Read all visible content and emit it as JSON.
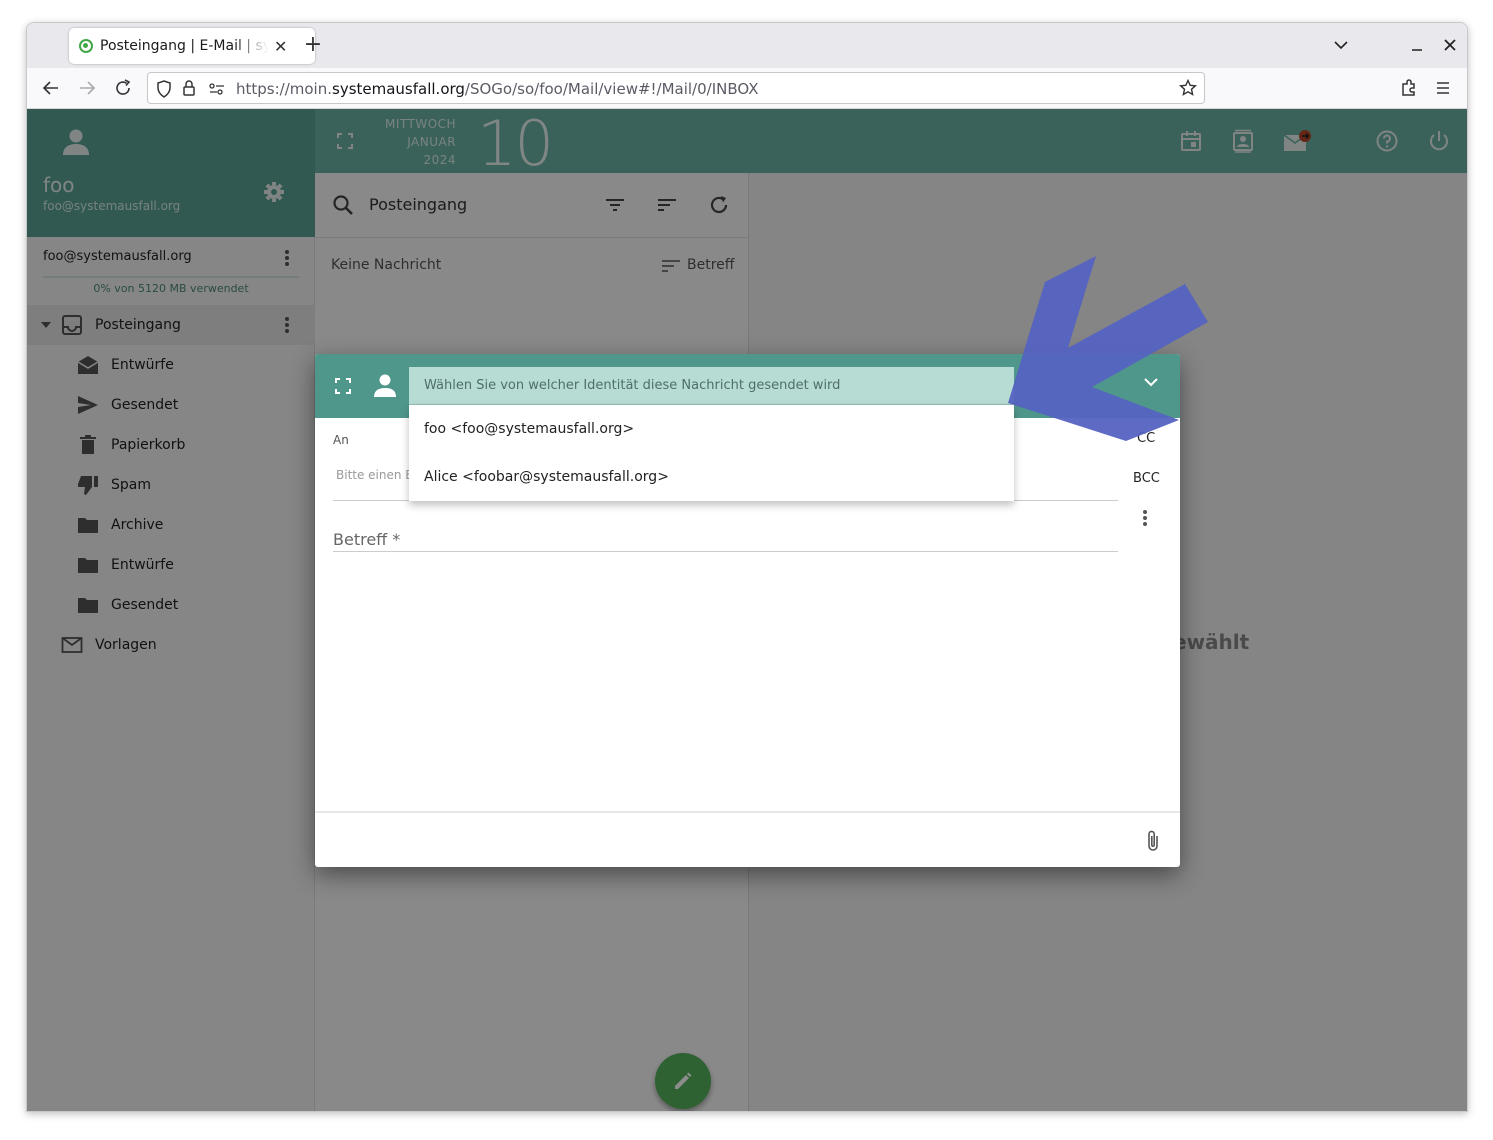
{
  "browser": {
    "tab_title": "Posteingang | E-Mail | systemausfall",
    "url_prefix": "https://moin.",
    "url_domain": "systemausfall.org",
    "url_path": "/SOGo/so/foo/Mail/view#!/Mail/0/INBOX"
  },
  "user": {
    "name": "foo",
    "email": "foo@systemausfall.org"
  },
  "account": {
    "label": "foo@systemausfall.org",
    "quota": "0% von 5120 MB verwendet"
  },
  "folders": [
    {
      "label": "Posteingang",
      "icon": "inbox-icon"
    },
    {
      "label": "Entwürfe",
      "icon": "drafts-icon"
    },
    {
      "label": "Gesendet",
      "icon": "send-icon"
    },
    {
      "label": "Papierkorb",
      "icon": "trash-icon"
    },
    {
      "label": "Spam",
      "icon": "thumb-down-icon"
    },
    {
      "label": "Archive",
      "icon": "folder-icon"
    },
    {
      "label": "Entwürfe",
      "icon": "folder-icon"
    },
    {
      "label": "Gesendet",
      "icon": "folder-icon"
    },
    {
      "label": "Vorlagen",
      "icon": "mail-icon"
    }
  ],
  "date": {
    "weekday": "MITTWOCH",
    "month": "JANUAR",
    "year": "2024",
    "day": "10"
  },
  "list": {
    "search_label": "Posteingang",
    "empty_text": "Keine Nachricht",
    "sort_label": "Betreff"
  },
  "view": {
    "text": "ewählt"
  },
  "compose": {
    "identity_placeholder": "Wählen Sie von welcher Identität diese Nachricht gesendet wird",
    "identities": [
      "foo <foo@systemausfall.org>",
      "Alice <foobar@systemausfall.org>"
    ],
    "to_label": "An",
    "to_hint": "Bitte einen E",
    "cc_label": "CC",
    "bcc_label": "BCC",
    "subject_label": "Betreff *"
  },
  "colors": {
    "accent": "#6bb3a4",
    "arrow": "#5563c1"
  }
}
